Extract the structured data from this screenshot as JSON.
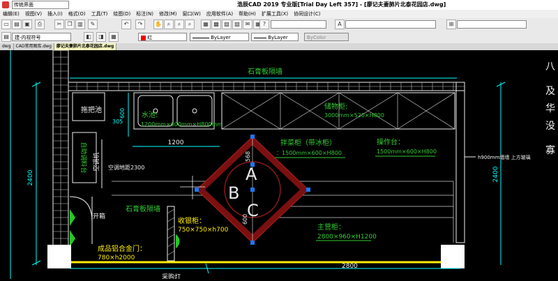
{
  "window": {
    "title": "浩辰CAD 2019 专业版[Trial Day Left 357] - [廖记夫妻肺片北泰花园店.dwg]",
    "workspace": "传统界面"
  },
  "menu": [
    "编辑(E)",
    "视图(V)",
    "插入(I)",
    "格式(O)",
    "工具(T)",
    "绘图(D)",
    "标注(N)",
    "修改(M)",
    "窗口(W)",
    "应用软件(A)",
    "帮助(H)",
    "扩展工具(X)",
    "协同设计(C)"
  ],
  "properties": {
    "layer": "建-内视符号",
    "color": "红",
    "linetype": "ByLayer",
    "lineweight": "ByLayer",
    "plotstyle": "ByColor"
  },
  "tabs": [
    "dwg",
    "CAD常用图库.dwg",
    "廖记夫妻肺片北泰花园店.dwg"
  ],
  "drawing": {
    "labels": {
      "gypsum_top": "石膏板隔墙",
      "mop_pool": "拖把池",
      "sink": "水池:",
      "sink_size": "1200mm×600mm×H800mm",
      "storage": "储物柜:",
      "storage_size": "3000mm×520×H800",
      "dim_1200": "1200",
      "dim_305": "305",
      "dim_600": "600",
      "dim_2400_left": "2400",
      "dim_2400_right": "2400",
      "dim_568": "568",
      "dim_2800": "2800",
      "prep_cabinet": "拌菜柜（带冰柜）",
      "prep_size": "：1500mm×600×H800",
      "work_table": "操作台：",
      "work_table_size": "1500mm×600×H800",
      "window_note": "h900mm墙墙  上方玻璃",
      "ac_label": "空调地距2300",
      "ac_vertical": "空调机",
      "cabinet_vertical": "自助调料台",
      "open_box": "开箱",
      "gypsum_mid": "石膏板隔墙",
      "cashier": "收银柜：",
      "cashier_size": "750×750×h700",
      "alu_door": "成品铝合金门：",
      "alu_door_size": "780×h2000",
      "counter": "主营柜：",
      "counter_size": "2800×960×H1200",
      "bottom_cut": "采购灯",
      "symbol_a": "A",
      "symbol_b": "B",
      "symbol_c": "C",
      "right_1": "八",
      "right_2": "及",
      "right_3": "华",
      "right_4": "没",
      "right_5": "寡"
    }
  },
  "colors": {
    "wall": "#f0f0f0",
    "dim_cyan": "#00ffff",
    "text_green": "#33cc33",
    "text_yellow": "#ffee00",
    "marker_red": "#a01818",
    "grip_blue": "#1a78ff",
    "fixture_green": "#22cc22"
  }
}
